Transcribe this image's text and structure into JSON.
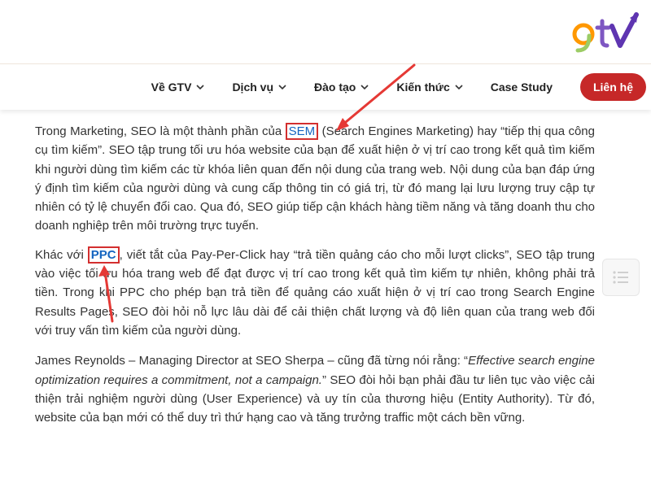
{
  "header": {
    "logo_alt": "gtv"
  },
  "nav": {
    "items": [
      {
        "label": "Về GTV",
        "has_dropdown": true
      },
      {
        "label": "Dịch vụ",
        "has_dropdown": true
      },
      {
        "label": "Đào tạo",
        "has_dropdown": true
      },
      {
        "label": "Kiến thức",
        "has_dropdown": true
      },
      {
        "label": "Case Study",
        "has_dropdown": false
      }
    ],
    "cta_label": "Liên hệ"
  },
  "content": {
    "p1": {
      "before": "Trong Marketing, SEO là một thành phần của ",
      "link": "SEM",
      "after": " (Search Engines Marketing) hay “tiếp thị qua công cụ tìm kiếm”. SEO tập trung tối ưu hóa website của bạn để xuất hiện ở vị trí cao trong kết quả tìm kiếm khi người dùng tìm kiếm các từ khóa liên quan đến nội dung của trang web. Nội dung của bạn đáp ứng ý định tìm kiếm của người dùng và cung cấp thông tin có giá trị, từ đó mang lại lưu lượng truy cập tự nhiên có tỷ lệ chuyển đổi cao. Qua đó, SEO giúp tiếp cận khách hàng tiềm năng và tăng doanh thu cho doanh nghiệp trên môi trường trực tuyến."
    },
    "p2": {
      "before": "Khác với ",
      "link": "PPC",
      "after": ", viết tắt của Pay-Per-Click hay “trả tiền quảng cáo cho mỗi lượt clicks”, SEO tập trung vào việc tối ưu hóa trang web để đạt được vị trí cao trong kết quả tìm kiếm tự nhiên, không phải trả tiền. Trong khi PPC cho phép bạn trả tiền để quảng cáo xuất hiện ở vị trí cao trong Search Engine Results Pages, SEO đòi hỏi nỗ lực lâu dài để cải thiện chất lượng và độ liên quan của trang web đối với truy vấn tìm kiếm của người dùng."
    },
    "p3": {
      "before": "James Reynolds – Managing Director at SEO Sherpa – cũng đã từng nói rằng: “",
      "quote": "Effective search engine optimization requires a commitment, not a campaign.",
      "after": "” SEO đòi hỏi bạn phải đầu tư liên tục vào việc cải thiện trải nghiệm người dùng (User Experience) và uy tín của thương hiệu (Entity Authority). Từ đó, website của bạn mới có thể duy trì thứ hạng cao và tăng trưởng traffic một cách bền vững."
    }
  },
  "colors": {
    "accent_red": "#c62828",
    "annotation_red": "#d32f2f",
    "link_blue": "#1565c0",
    "logo_green": "#9ccc65",
    "logo_purple": "#5e35b1"
  },
  "icons": {
    "chevron": "chevron-down-icon",
    "toc": "table-of-contents-icon",
    "annotation": "arrow-annotation"
  }
}
